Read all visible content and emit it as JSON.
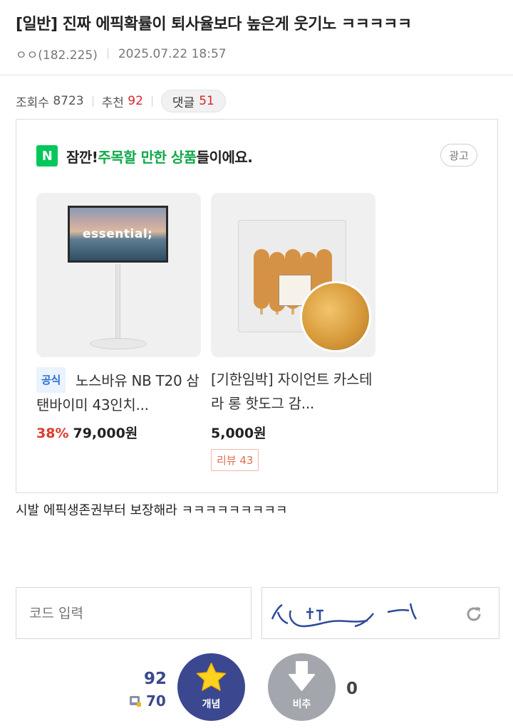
{
  "post": {
    "title": "[일반] 진짜 에픽확률이 퇴사율보다 높은게 웃기노 ㅋㅋㅋㅋㅋ",
    "author": "ㅇㅇ(182.225)",
    "date": "2025.07.22 18:57",
    "body": "시발 에픽생존권부터 보장해라 ㅋㅋㅋㅋㅋㅋㅋㅋㅋ"
  },
  "stats": {
    "views_label": "조회수",
    "views": "8723",
    "recommend_label": "추천",
    "recommend": "92",
    "comments_label": "댓글",
    "comments": "51"
  },
  "ad": {
    "logo": "N",
    "headline_prefix": "잠깐! ",
    "headline_highlight": "주목할 만한 상품",
    "headline_suffix": "들이에요.",
    "badge": "광고",
    "products": [
      {
        "official_badge": "공식",
        "name": "노스바유 NB T20 삼탠바이미 43인치...",
        "discount": "38%",
        "price": "79,000원",
        "image_text": "essential;"
      },
      {
        "name": "[기한임박] 자이언트 카스테라 롱 핫도그 감...",
        "price": "5,000원",
        "review_badge": "리뷰 43"
      }
    ]
  },
  "captcha": {
    "placeholder": "코드 입력"
  },
  "vote": {
    "up_count": "92",
    "fix_count": "70",
    "up_label": "개념",
    "down_label": "비추",
    "down_count": "0"
  },
  "icons": {
    "refresh": "refresh-icon",
    "star": "star-icon",
    "down_arrow": "down-arrow-icon"
  },
  "colors": {
    "accent_red": "#d8262b",
    "naver_green": "#03c75a",
    "vote_blue": "#3b4890",
    "vote_gray": "#a4a6ad"
  }
}
